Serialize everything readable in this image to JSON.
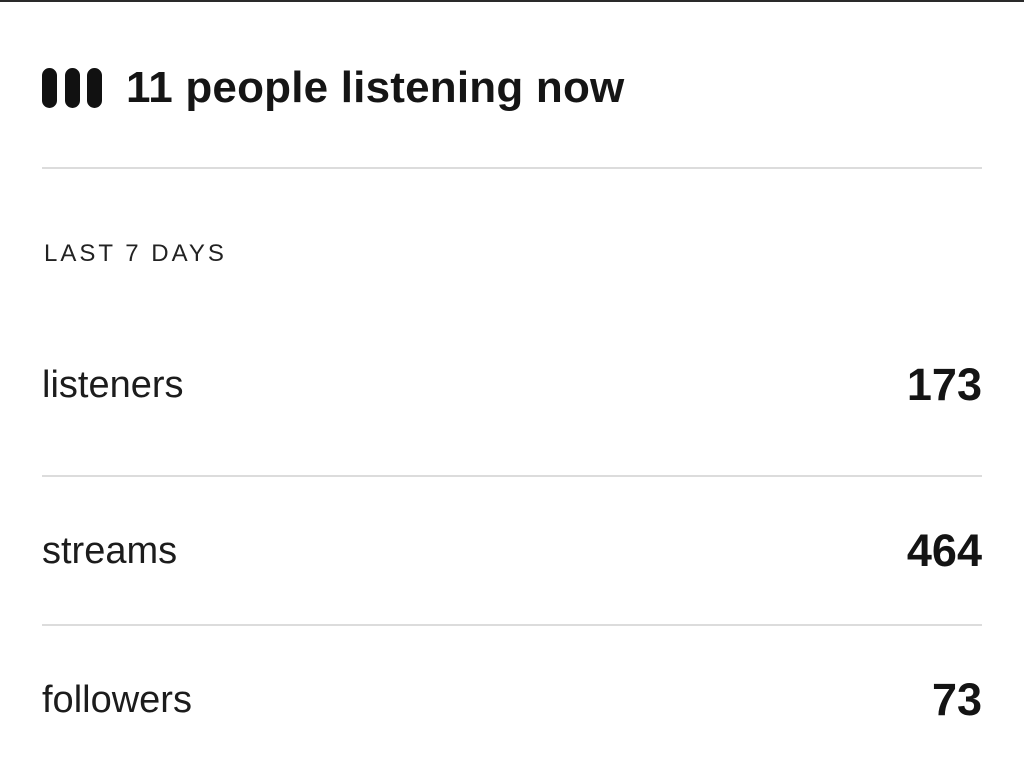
{
  "now": {
    "icon": "listening-bars-icon",
    "text": "11 people listening now"
  },
  "section": {
    "label": "LAST 7 DAYS"
  },
  "stats": [
    {
      "label": "listeners",
      "value": "173"
    },
    {
      "label": "streams",
      "value": "464"
    },
    {
      "label": "followers",
      "value": "73"
    }
  ]
}
